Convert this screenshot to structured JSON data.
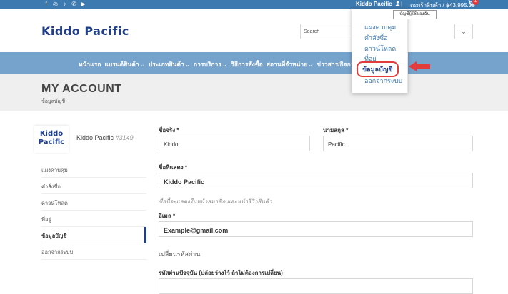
{
  "topbar": {
    "social_icons": [
      "facebook-icon",
      "instagram-icon",
      "tiktok-icon",
      "phone-icon",
      "youtube-icon"
    ],
    "social_glyphs": [
      "f",
      "◎",
      "♪",
      "✆",
      "▶"
    ],
    "account_name": "Kiddo Pacific",
    "separator": "|",
    "cart_label": "ตะกร้าสินค้า / ฿43,995.00",
    "cart_count": "1"
  },
  "tooltip": "บัญชีผู้ใช้ของฉัน",
  "header": {
    "logo_text": "Kiddo Pacific",
    "search_placeholder": "Search",
    "search_select_icon": "⌄"
  },
  "nav": {
    "items": [
      {
        "label": "หน้าแรก",
        "chevron": ""
      },
      {
        "label": "แบรนด์สินค้า",
        "chevron": "⌄"
      },
      {
        "label": "ประเภทสินค้า",
        "chevron": "⌄"
      },
      {
        "label": "การบริการ",
        "chevron": "⌄"
      },
      {
        "label": "วิธีการสั่งซื้อ",
        "chevron": ""
      },
      {
        "label": "สถานที่จำหน่าย",
        "chevron": "⌄"
      },
      {
        "label": "ข่าวสาร/กิจกร",
        "chevron": ""
      }
    ]
  },
  "dropdown": {
    "items": [
      "แผงควบคุม",
      "คำสั่งซื้อ",
      "ดาวน์โหลด",
      "ที่อยู่",
      "ข้อมูลบัญชี",
      "ออกจากระบบ"
    ],
    "highlighted_index": 4
  },
  "banner": {
    "title": "MY ACCOUNT",
    "breadcrumb": "ข้อมูลบัญชี"
  },
  "sidebar": {
    "logo_line1": "Kiddo",
    "logo_line2": "Pacific",
    "user_name": "Kiddo Pacific",
    "user_id": "#3149",
    "items": [
      "แผงควบคุม",
      "คำสั่งซื้อ",
      "ดาวน์โหลด",
      "ที่อยู่",
      "ข้อมูลบัญชี",
      "ออกจากระบบ"
    ],
    "active_index": 4
  },
  "form": {
    "first_name_label": "ชื่อจริง *",
    "first_name_value": "Kiddo",
    "last_name_label": "นามสกุล *",
    "last_name_value": "Pacific",
    "display_name_label": "ชื่อที่แสดง *",
    "display_name_value": "Kiddo Pacific",
    "display_name_hint": "ชื่อนี้จะแสดงในหน้าสมาชิก และหน้ารีวิวสินค้า",
    "email_label": "อีเมล *",
    "email_value": "Example@gmail.com",
    "password_section": "เปลี่ยนรหัสผ่าน",
    "current_password_label": "รหัสผ่านปัจจุบัน (ปล่อยว่างไว้ ถ้าไม่ต้องการเปลี่ยน)"
  },
  "colors": {
    "topbar": "#3d7ab0",
    "nav": "#76a3cc",
    "brand": "#1f3e8a",
    "highlight": "#e23c3c"
  }
}
